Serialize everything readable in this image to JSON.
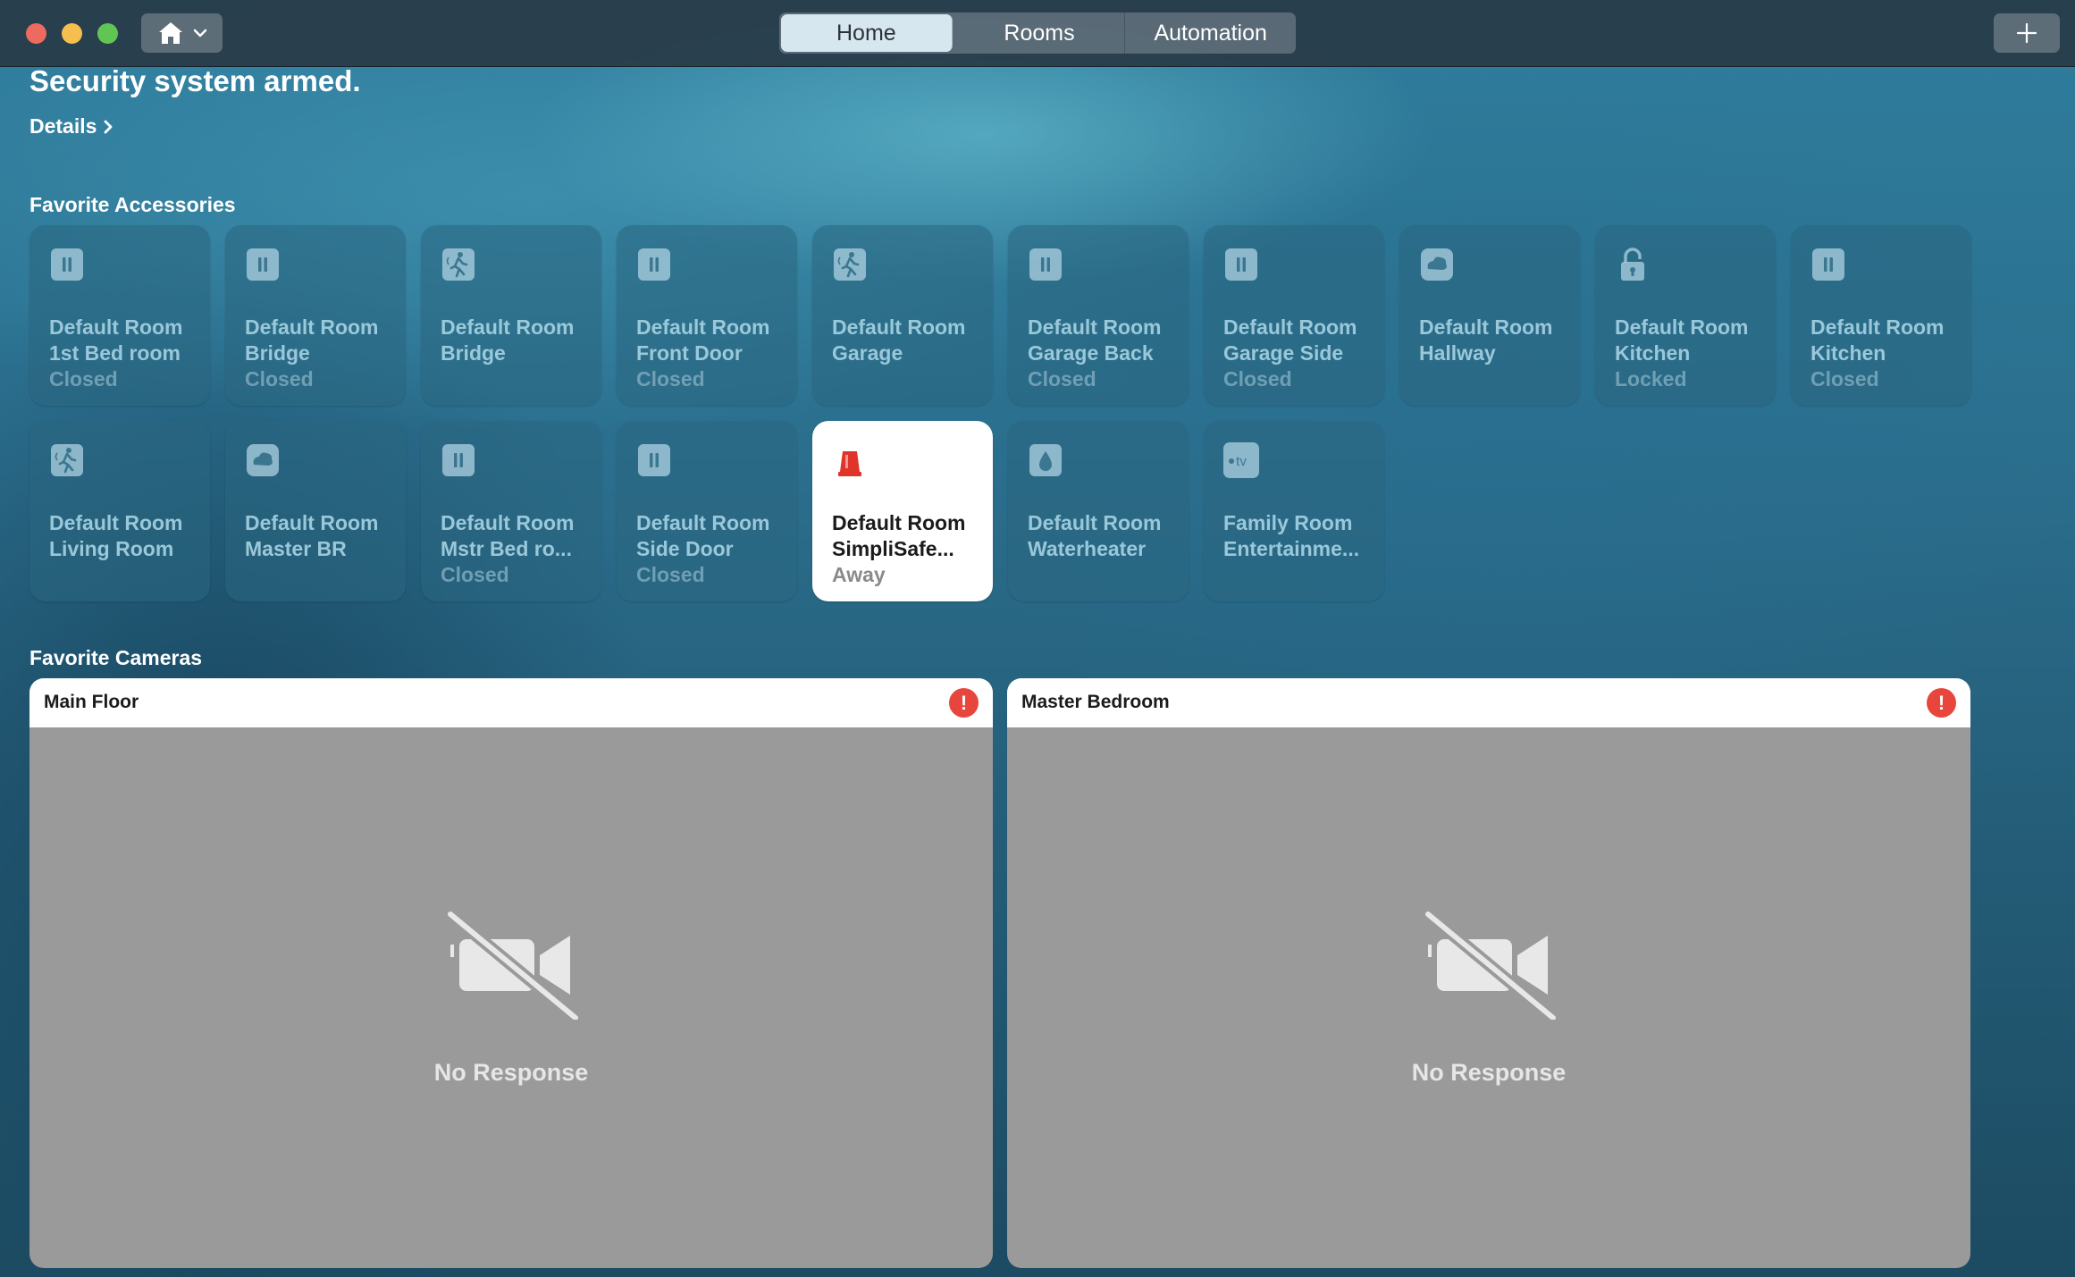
{
  "window": {
    "tabs": [
      {
        "label": "Home",
        "active": true
      },
      {
        "label": "Rooms",
        "active": false
      },
      {
        "label": "Automation",
        "active": false
      }
    ],
    "add_icon": "plus-icon",
    "home_menu_icon": "house-icon"
  },
  "header": {
    "status": "Security system armed.",
    "details_label": "Details"
  },
  "favorites": {
    "title": "Favorite Accessories",
    "tiles": [
      {
        "line1": "Default Room",
        "line2": "1st Bed room",
        "status": "Closed",
        "icon": "contact-sensor-icon"
      },
      {
        "line1": "Default Room",
        "line2": "Bridge",
        "status": "Closed",
        "icon": "contact-sensor-icon"
      },
      {
        "line1": "Default Room",
        "line2": "Bridge",
        "status": "",
        "icon": "motion-sensor-icon"
      },
      {
        "line1": "Default Room",
        "line2": "Front Door",
        "status": "Closed",
        "icon": "contact-sensor-icon"
      },
      {
        "line1": "Default Room",
        "line2": "Garage",
        "status": "",
        "icon": "motion-sensor-icon"
      },
      {
        "line1": "Default Room",
        "line2": "Garage Back",
        "status": "Closed",
        "icon": "contact-sensor-icon"
      },
      {
        "line1": "Default Room",
        "line2": "Garage Side",
        "status": "Closed",
        "icon": "contact-sensor-icon"
      },
      {
        "line1": "Default Room",
        "line2": "Hallway",
        "status": "",
        "icon": "smoke-sensor-icon"
      },
      {
        "line1": "Default Room",
        "line2": "Kitchen",
        "status": "Locked",
        "icon": "lock-icon"
      },
      {
        "line1": "Default Room",
        "line2": "Kitchen",
        "status": "Closed",
        "icon": "contact-sensor-icon"
      },
      {
        "line1": "Default Room",
        "line2": "Living Room",
        "status": "",
        "icon": "motion-sensor-icon"
      },
      {
        "line1": "Default Room",
        "line2": "Master BR",
        "status": "",
        "icon": "smoke-sensor-icon"
      },
      {
        "line1": "Default Room",
        "line2": "Mstr Bed ro...",
        "status": "Closed",
        "icon": "contact-sensor-icon"
      },
      {
        "line1": "Default Room",
        "line2": "Side Door",
        "status": "Closed",
        "icon": "contact-sensor-icon"
      },
      {
        "line1": "Default Room",
        "line2": "SimpliSafe...",
        "status": "Away",
        "icon": "security-alarm-icon",
        "active": true
      },
      {
        "line1": "Default Room",
        "line2": "Waterheater",
        "status": "",
        "icon": "leak-sensor-icon"
      },
      {
        "line1": "Family Room",
        "line2": "Entertainme...",
        "status": "",
        "icon": "apple-tv-icon"
      }
    ]
  },
  "cameras": {
    "title": "Favorite Cameras",
    "items": [
      {
        "name": "Main Floor",
        "message": "No Response",
        "alert": "!"
      },
      {
        "name": "Master Bedroom",
        "message": "No Response",
        "alert": "!"
      }
    ]
  },
  "colors": {
    "accent_alert": "#e8453c",
    "alarm_red": "#e0342b",
    "tile_active_bg": "#ffffff"
  }
}
